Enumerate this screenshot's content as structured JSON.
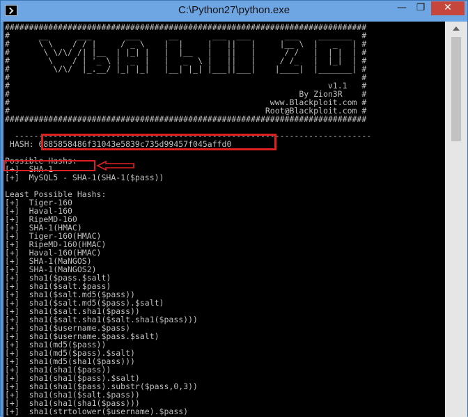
{
  "window": {
    "title": "C:\\Python27\\python.exe",
    "min_glyph": "—",
    "max_glyph": "❐",
    "close_glyph": "✕"
  },
  "banner": [
    "###########################################################################",
    "#      __      ___       ___      __       ___  ___       ___    _______  #",
    "#      \\ \\    / / |     / _ \\    |  |     |   ||   |     |__ \\  |   _   | #",
    "#       \\ \\/\\/ /| |__  | |_| |   |  |__   |   ||   |      / /   |  | |  | #",
    "#        \\    / | '_ \\ |  _  |   |   _  \\ |   ||   |     / /_   |  |_|  | #",
    "#         \\/\\/  |_.__/ |_| |_|   |__| |_| |___||___|    |____|  |_______| #",
    "#                                                                         #",
    "#                                                                  v1.1   #",
    "#                                                            By Zion3R    #",
    "#                                                      www.Blackploit.com #",
    "#                                                     Root@Blackploit.com #",
    "###########################################################################"
  ],
  "separator": "  --------------------------------------------------------------------------",
  "hash_label": " HASH:",
  "hash_value": "6885858486f31043e5839c735d99457f045affd0",
  "possible_title": "Possible Hashs:",
  "possible": [
    "[+]  SHA-1",
    "[+]  MySQL5 - SHA-1(SHA-1($pass))"
  ],
  "least_title": "Least Possible Hashs:",
  "least": [
    "[+]  Tiger-160",
    "[+]  Haval-160",
    "[+]  RipeMD-160",
    "[+]  SHA-1(HMAC)",
    "[+]  Tiger-160(HMAC)",
    "[+]  RipeMD-160(HMAC)",
    "[+]  Haval-160(HMAC)",
    "[+]  SHA-1(MaNGOS)",
    "[+]  SHA-1(MaNGOS2)",
    "[+]  sha1($pass.$salt)",
    "[+]  sha1($salt.$pass)",
    "[+]  sha1($salt.md5($pass))",
    "[+]  sha1($salt.md5($pass).$salt)",
    "[+]  sha1($salt.sha1($pass))",
    "[+]  sha1($salt.sha1($salt.sha1($pass)))",
    "[+]  sha1($username.$pass)",
    "[+]  sha1($username.$pass.$salt)",
    "[+]  sha1(md5($pass))",
    "[+]  sha1(md5($pass).$salt)",
    "[+]  sha1(md5(sha1($pass)))",
    "[+]  sha1(sha1($pass))",
    "[+]  sha1(sha1($pass).$salt)",
    "[+]  sha1(sha1($pass).substr($pass,0,3))",
    "[+]  sha1(sha1($salt.$pass))",
    "[+]  sha1(sha1(sha1($pass)))",
    "[+]  sha1(strtolower($username).$pass)"
  ],
  "colors": {
    "highlight": "#e02020",
    "console_text": "#c0c0c0",
    "console_bg": "#000000"
  }
}
